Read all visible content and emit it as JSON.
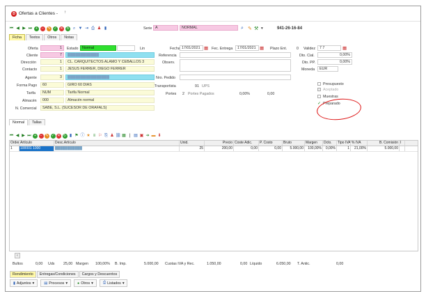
{
  "window": {
    "title": "Ofertas a Clientes -",
    "title_suffix": "↑"
  },
  "toolbar": {
    "serie_label": "Serie",
    "serie_value": "A",
    "serie_desc": "NORMAL",
    "doc_number": "941-26-16-84"
  },
  "tabs": [
    "Ficha",
    "Textos",
    "Otros",
    "Notas"
  ],
  "form": {
    "oferta_label": "Oferta",
    "oferta_value": "1",
    "estado_label": "Estado",
    "estado_value": "Normal",
    "lin_label": "Lin",
    "cliente_label": "Cliente",
    "cliente_value": "7",
    "cliente_name": "████████████",
    "direccion_label": "Dirección",
    "direccion_value": "1",
    "direccion_text": "CL. CARQUITECTOS ALAMO Y CEBALLOS 3",
    "contacto_label": "Contacto",
    "contacto_value": "1",
    "contacto_text": "JESUS FERRER, DIEGO FERRER",
    "agente_label": "Agente",
    "agente_value": "3",
    "agente_name": "████████████████",
    "formapago_label": "Forma Pago",
    "formapago_value": "60",
    "formapago_text": "GIRO 60 DIAS",
    "tarifa_label": "Tarifa",
    "tarifa_value": "NUM",
    "tarifa_text": "Tarifa Normal",
    "almacen_label": "Almacén",
    "almacen_value": "000",
    "almacen_text": "Almacén normal",
    "ncomercial_label": "N. Comercial",
    "ncomercial_text": "SABE, S.L. (SUCESOR DE ORAFALS)",
    "fecha_label": "Fecha",
    "fecha_value": "17/01/2021",
    "fentrega_label": "Fec. Entrega",
    "fentrega_value": "17/01/2021",
    "plazo_label": "Plazo Ent.",
    "plazo_value": "0",
    "validez_label": "Validez",
    "validez_value": "7 7",
    "referencia_label": "Referencia",
    "observ_label": "Observ.",
    "npedido_label": "Nro. Pedido",
    "transportista_label": "Transportista",
    "transportista_value": "91",
    "transportista_text": "UPS",
    "portes_label": "Portes",
    "portes_value": "2",
    "portes_text": "Portes Pagados",
    "portes_pct": "0,00%",
    "portes_amount": "0,00",
    "dtocial_label": "Dto. Cial.",
    "dtocial_value": "0,00%",
    "dtopp_label": "Dto. PP.",
    "dtopp_value": "0,00%",
    "moneda_label": "Moneda",
    "moneda_value": "EUR",
    "chk_presupuesto": "Presupuesto",
    "chk_aceptado": "Aceptado",
    "chk_muestras": "Muestras",
    "chk_preparado": "Preparado"
  },
  "subtabs": [
    "Normal",
    "Tallas"
  ],
  "grid": {
    "headers": [
      "Orden",
      "Artículo",
      "Desc.Artículo",
      "Unid.",
      "Precio",
      "Coste Adic.",
      "P. Costo",
      "Bruto",
      "Margen",
      "Dcto.",
      "Tipo IVA",
      "% IVA",
      "B. Comisión",
      "I"
    ],
    "rows": [
      [
        "1",
        "100001 1000",
        "███████████",
        "25",
        "200,00",
        "0,00",
        "0,00",
        "5.000,00",
        "100,00%",
        "0,00%",
        "1",
        "21,00%",
        "5.000,00",
        ""
      ]
    ]
  },
  "totals": {
    "bultos_label": "Bultos",
    "bultos_value": "0,00",
    "uds_label": "Uds",
    "uds_value": "25,00",
    "margen_label": "Margen",
    "margen_value": "100,00%",
    "bimp_label": "B. Imp.",
    "bimp_value": "5.000,00",
    "cuotas_label": "Cuotas IVA y Rec.",
    "cuotas_value": "1.050,00",
    "liquido_label": "Líquido",
    "liquido_pre": "0,00",
    "liquido_value": "6.050,00",
    "tanticipo_label": "T. Antic.",
    "tanticipo_value": "0,00"
  },
  "bottom_tabs": [
    "Rendimiento",
    "Entregas/Condiciones",
    "Cargos y Descuentos"
  ],
  "actions": [
    "Adjuntos",
    "Procesos",
    "Otros",
    "Listados"
  ],
  "colors": {
    "annotation": "#dd1111",
    "selected_row": "#1a73c9",
    "active_tab": "#fff8a8"
  }
}
